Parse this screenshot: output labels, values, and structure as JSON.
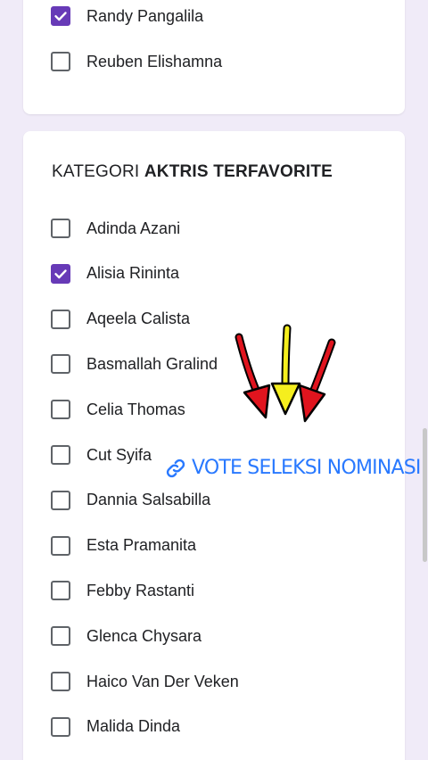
{
  "top_options": [
    {
      "label": "Randy Pangalila",
      "checked": true
    },
    {
      "label": "Reuben Elishamna",
      "checked": false
    }
  ],
  "category": {
    "prefix": "KATEGORI",
    "bold": "AKTRIS TERFAVORITE"
  },
  "options": [
    {
      "label": "Adinda Azani",
      "checked": false
    },
    {
      "label": "Alisia Rininta",
      "checked": true
    },
    {
      "label": "Aqeela Calista",
      "checked": false
    },
    {
      "label": "Basmallah Gralind",
      "checked": false
    },
    {
      "label": "Celia Thomas",
      "checked": false
    },
    {
      "label": "Cut Syifa",
      "checked": false
    },
    {
      "label": "Dannia Salsabilla",
      "checked": false
    },
    {
      "label": "Esta Pramanita",
      "checked": false
    },
    {
      "label": "Febby Rastanti",
      "checked": false
    },
    {
      "label": "Glenca Chysara",
      "checked": false
    },
    {
      "label": "Haico Van Der Veken",
      "checked": false
    },
    {
      "label": "Malida Dinda",
      "checked": false
    }
  ],
  "overlay": {
    "vote_link_text": "VOTE SELEKSI NOMINASI",
    "link_icon": "link-icon",
    "arrow_colors": [
      "#e0141e",
      "#f5ee1e",
      "#e0141e"
    ]
  },
  "colors": {
    "checkbox_checked": "#673ab7",
    "page_bg": "#f0ebf8",
    "link": "#2979ff"
  }
}
